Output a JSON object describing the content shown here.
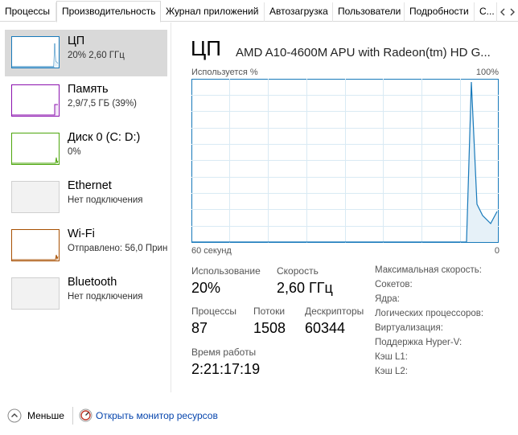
{
  "tabs": [
    {
      "label": "Процессы"
    },
    {
      "label": "Производительность"
    },
    {
      "label": "Журнал приложений"
    },
    {
      "label": "Автозагрузка"
    },
    {
      "label": "Пользователи"
    },
    {
      "label": "Подробности"
    },
    {
      "label": "С..."
    }
  ],
  "colors": {
    "cpu": "#1779ba",
    "memory": "#8b12ae",
    "disk": "#4da60c",
    "wifi": "#a74f01",
    "selected_bg": "#d9d9d9",
    "grid": "#d9eaf4"
  },
  "sidebar": {
    "items": [
      {
        "title": "ЦП",
        "subtitle": "20% 2,60 ГГц",
        "icon": "cpu-thumbnail-graph"
      },
      {
        "title": "Память",
        "subtitle": "2,9/7,5 ГБ (39%)",
        "icon": "memory-thumbnail-graph"
      },
      {
        "title": "Диск 0 (C: D:)",
        "subtitle": "0%",
        "icon": "disk-thumbnail-graph"
      },
      {
        "title": "Ethernet",
        "subtitle": "Нет подключения",
        "icon": "ethernet-thumbnail-graph"
      },
      {
        "title": "Wi-Fi",
        "subtitle": "Отправлено: 56,0 Прин",
        "icon": "wifi-thumbnail-graph"
      },
      {
        "title": "Bluetooth",
        "subtitle": "Нет подключения",
        "icon": "bluetooth-thumbnail-graph"
      }
    ]
  },
  "main": {
    "title": "ЦП",
    "model": "AMD A10-4600M APU with Radeon(tm) HD G...",
    "axis": {
      "top_left": "Используется %",
      "top_right": "100%",
      "bottom_left": "60 секунд",
      "bottom_right": "0"
    },
    "stats": {
      "usage_label": "Использование",
      "usage_value": "20%",
      "speed_label": "Скорость",
      "speed_value": "2,60 ГГц",
      "processes_label": "Процессы",
      "processes_value": "87",
      "threads_label": "Потоки",
      "threads_value": "1508",
      "handles_label": "Дескрипторы",
      "handles_value": "60344",
      "uptime_label": "Время работы",
      "uptime_value": "2:21:17:19"
    },
    "specs": [
      {
        "label": "Максимальная скорость:"
      },
      {
        "label": "Сокетов:"
      },
      {
        "label": "Ядра:"
      },
      {
        "label": "Логических процессоров:"
      },
      {
        "label": "Виртуализация:"
      },
      {
        "label": "Поддержка Hyper-V:"
      },
      {
        "label": "Кэш L1:"
      },
      {
        "label": "Кэш L2:"
      }
    ]
  },
  "footer": {
    "less_label": "Меньше",
    "resource_monitor_label": "Открыть монитор ресурсов"
  }
}
